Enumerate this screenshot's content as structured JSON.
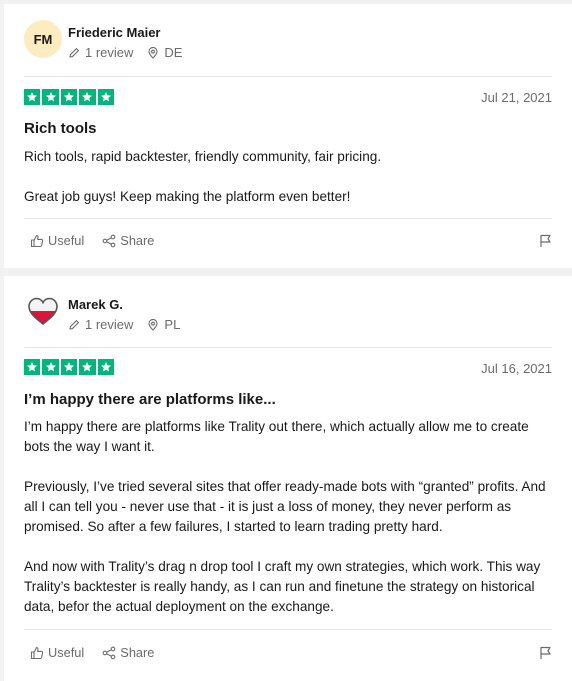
{
  "reviews": [
    {
      "initials": "FM",
      "name": "Friederic Maier",
      "review_count": "1 review",
      "country": "DE",
      "date": "Jul 21, 2021",
      "rating": 5,
      "title": "Rich tools",
      "paragraphs": [
        "Rich tools, rapid backtester, friendly community, fair pricing.",
        "Great job guys! Keep making the platform even better!"
      ],
      "useful_label": "Useful",
      "share_label": "Share"
    },
    {
      "initials": "",
      "name": "Marek G.",
      "review_count": "1 review",
      "country": "PL",
      "date": "Jul 16, 2021",
      "rating": 5,
      "title": "I’m happy there are platforms like...",
      "paragraphs": [
        "I’m happy there are platforms like Trality out there, which actually allow me to create bots the way I want it.",
        "Previously, I’ve tried several sites that offer ready-made bots with “granted” profits. And all I can tell you - never use that - it is just a loss of money, they never perform as promised. So after a few failures, I started to learn trading pretty hard.",
        "And now with Trality’s drag n drop tool I craft my own strategies, which work. This way Trality’s backtester is really handy, as I can run and finetune the strategy on historical data, befor the actual deployment on the exchange."
      ],
      "useful_label": "Useful",
      "share_label": "Share"
    }
  ],
  "colors": {
    "star_green": "#00b67a",
    "avatar_bg": "#fcecbf",
    "flag_red": "#dc143c"
  }
}
